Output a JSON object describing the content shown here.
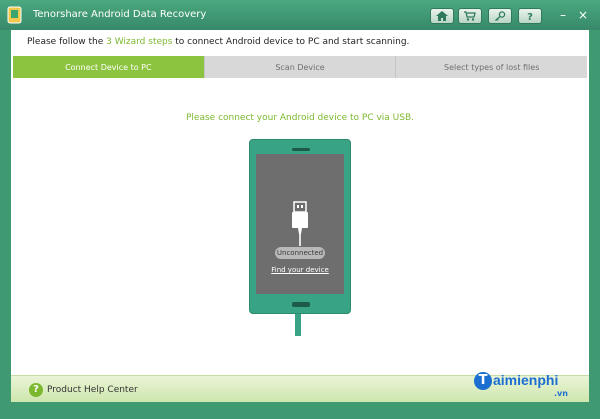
{
  "window": {
    "title": "Tenorshare Android Data Recovery",
    "controls": {
      "minimize": "–",
      "close": "×"
    },
    "toolbar_icons": [
      "home-icon",
      "cart-icon",
      "key-icon",
      "help-icon"
    ]
  },
  "instructions": {
    "prefix": "Please follow the ",
    "highlight": "3 Wizard steps",
    "suffix": " to connect Android device to PC and start scanning."
  },
  "steps": [
    {
      "label": "Connect Device to PC",
      "state": "active"
    },
    {
      "label": "Scan Device",
      "state": "inactive"
    },
    {
      "label": "Select types of lost files",
      "state": "inactive"
    }
  ],
  "main": {
    "connect_message": "Please connect your Android device to PC via USB.",
    "status": "Unconnected",
    "find_device_link": "Find your device"
  },
  "footer": {
    "help_label": "Product Help Center",
    "help_icon_glyph": "?"
  },
  "watermark": {
    "initial": "T",
    "text": "aimienphi",
    "suffix": ".vn"
  },
  "colors": {
    "window_green": "#3f9a72",
    "accent_green": "#8cc43f",
    "text_green": "#7cb82f",
    "phone_teal": "#39a385"
  }
}
